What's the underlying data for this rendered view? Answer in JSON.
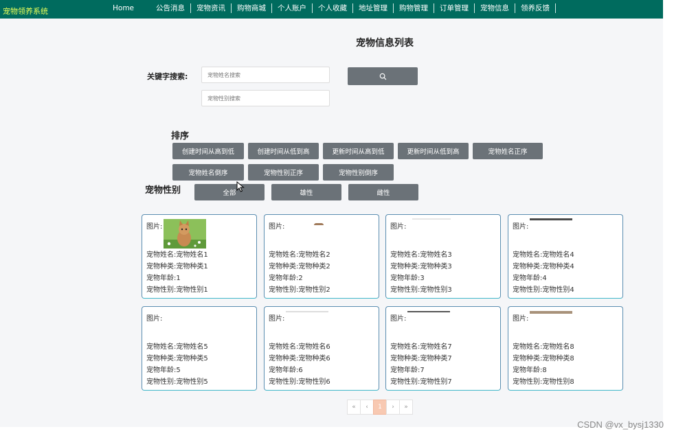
{
  "app": {
    "title": "宠物领养系统"
  },
  "nav": {
    "items": [
      "Home",
      "公告消息",
      "宠物资讯",
      "购物商城",
      "个人账户",
      "个人收藏",
      "地址管理",
      "购物管理",
      "订单管理",
      "宠物信息",
      "领养反馈"
    ]
  },
  "page": {
    "title": "宠物信息列表"
  },
  "search": {
    "label": "关键字搜索:",
    "name_placeholder": "宠物姓名搜索",
    "sex_placeholder": "宠物性别搜索",
    "button_icon": "search-icon"
  },
  "sort": {
    "title": "排序",
    "buttons": [
      "创建时间从高到低",
      "创建时间从低到高",
      "更新时间从高到低",
      "更新时间从低到高",
      "宠物姓名正序",
      "宠物姓名倒序",
      "宠物性别正序",
      "宠物性别倒序"
    ]
  },
  "gender": {
    "title": "宠物性别",
    "buttons": [
      "全部",
      "雄性",
      "雌性"
    ]
  },
  "cards": [
    {
      "pic": "图片:",
      "name": "宠物姓名:宠物姓名1",
      "type": "宠物种类:宠物种类1",
      "age": "宠物年龄:1",
      "sex": "宠物性别:宠物性别1"
    },
    {
      "pic": "图片:",
      "name": "宠物姓名:宠物姓名2",
      "type": "宠物种类:宠物种类2",
      "age": "宠物年龄:2",
      "sex": "宠物性别:宠物性别2"
    },
    {
      "pic": "图片:",
      "name": "宠物姓名:宠物姓名3",
      "type": "宠物种类:宠物种类3",
      "age": "宠物年龄:3",
      "sex": "宠物性别:宠物性别3"
    },
    {
      "pic": "图片:",
      "name": "宠物姓名:宠物姓名4",
      "type": "宠物种类:宠物种类4",
      "age": "宠物年龄:4",
      "sex": "宠物性别:宠物性别4"
    },
    {
      "pic": "图片:",
      "name": "宠物姓名:宠物姓名5",
      "type": "宠物种类:宠物种类5",
      "age": "宠物年龄:5",
      "sex": "宠物性别:宠物性别5"
    },
    {
      "pic": "图片:",
      "name": "宠物姓名:宠物姓名6",
      "type": "宠物种类:宠物种类6",
      "age": "宠物年龄:6",
      "sex": "宠物性别:宠物性别6"
    },
    {
      "pic": "图片:",
      "name": "宠物姓名:宠物姓名7",
      "type": "宠物种类:宠物种类7",
      "age": "宠物年龄:7",
      "sex": "宠物性别:宠物性别7"
    },
    {
      "pic": "图片:",
      "name": "宠物姓名:宠物姓名8",
      "type": "宠物种类:宠物种类8",
      "age": "宠物年龄:8",
      "sex": "宠物性别:宠物性别8"
    }
  ],
  "pagination": {
    "first": "«",
    "prev": "‹",
    "current": "1",
    "next": "›",
    "last": "»"
  },
  "watermark": "CSDN @vx_bysj1330",
  "colors": {
    "nav_bg": "#006b5e",
    "brand": "#e8ff5a",
    "button_bg": "#6b7278",
    "card_border": "#5a8db0",
    "page_active": "#f8c9b2"
  }
}
